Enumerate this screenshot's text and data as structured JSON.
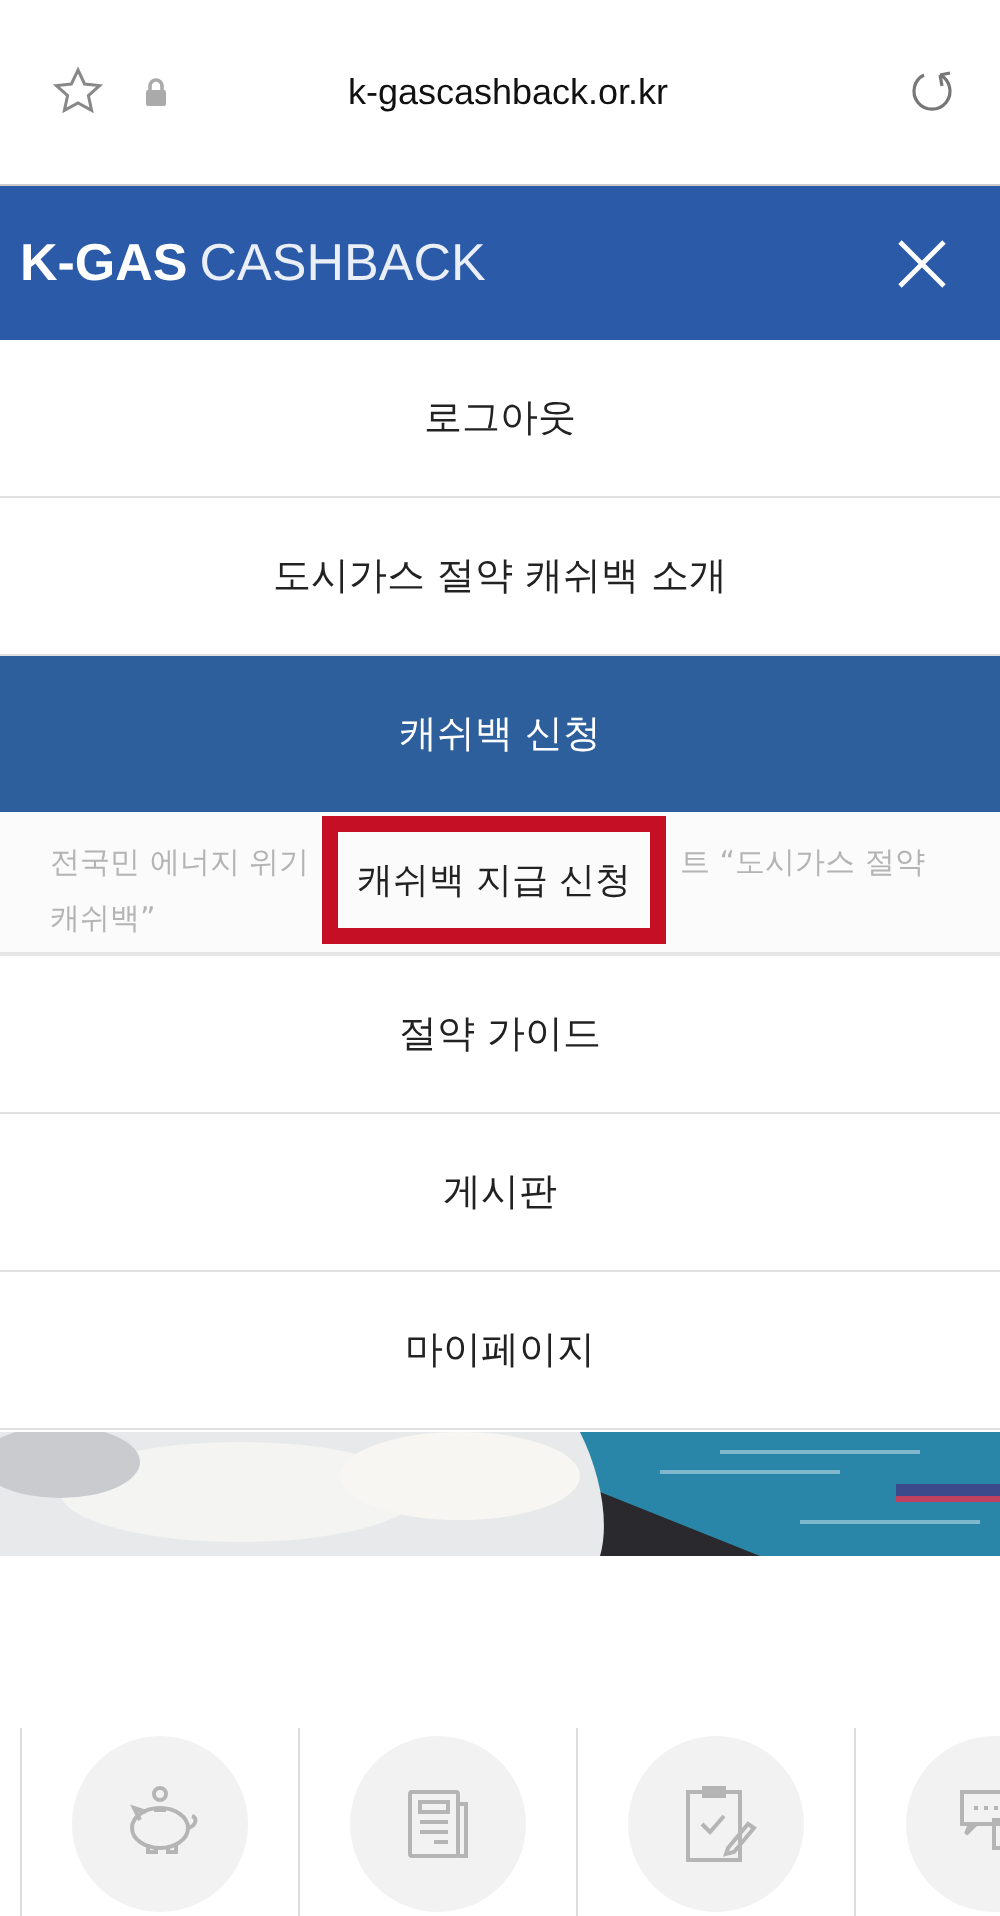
{
  "browser_bar": {
    "url": "k-gascashback.or.kr"
  },
  "header": {
    "logo_bold": "K-GAS",
    "logo_light": "CASHBACK"
  },
  "menu": [
    {
      "label": "로그아웃",
      "selected": false
    },
    {
      "label": "도시가스 절약 캐쉬백 소개",
      "selected": false
    },
    {
      "label": "캐쉬백 신청",
      "selected": true,
      "submenu": {
        "background_texts": [
          "전국민 에너지 위기",
          "트 “도시가스 절약",
          "캐쉬백”"
        ],
        "items": [
          {
            "label": "캐쉬백 지급 신청",
            "highlighted": true
          }
        ]
      }
    },
    {
      "label": "절약 가이드",
      "selected": false
    },
    {
      "label": "게시판",
      "selected": false
    },
    {
      "label": "마이페이지",
      "selected": false
    }
  ],
  "quick_links": [
    {
      "kind": "piggy"
    },
    {
      "kind": "news"
    },
    {
      "kind": "clipboard"
    },
    {
      "kind": "chat"
    }
  ]
}
